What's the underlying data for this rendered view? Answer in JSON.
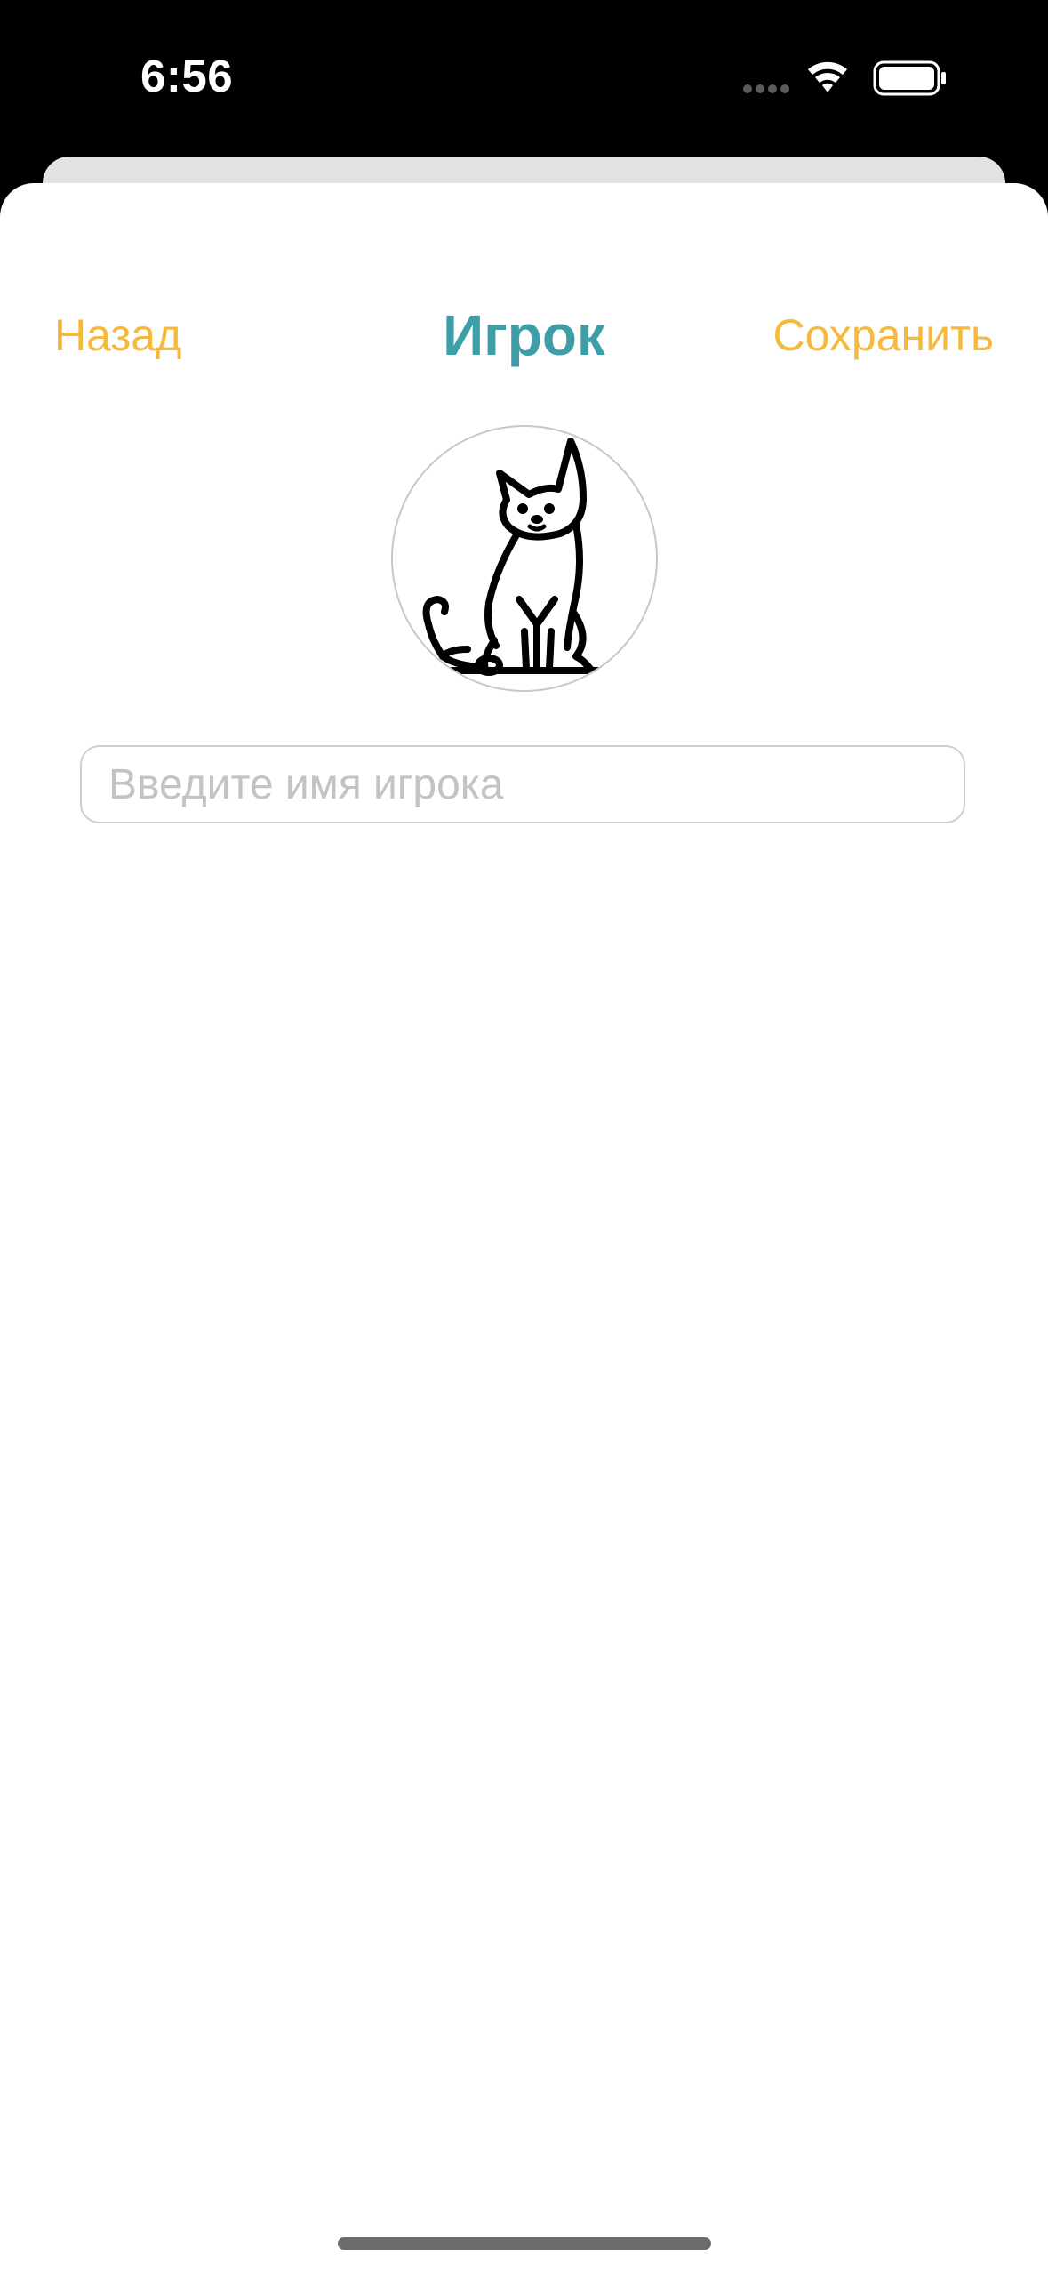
{
  "status_bar": {
    "time": "6:56",
    "icons": [
      "cellular-dots-icon",
      "wifi-icon",
      "battery-icon"
    ]
  },
  "nav": {
    "back_label": "Назад",
    "title": "Игрок",
    "save_label": "Сохранить"
  },
  "avatar": {
    "icon": "cat-icon"
  },
  "name_field": {
    "value": "",
    "placeholder": "Введите имя игрока"
  },
  "colors": {
    "accent": "#f5b93e",
    "title": "#3d9ea8",
    "background": "#ffffff",
    "status_bar": "#000000"
  }
}
